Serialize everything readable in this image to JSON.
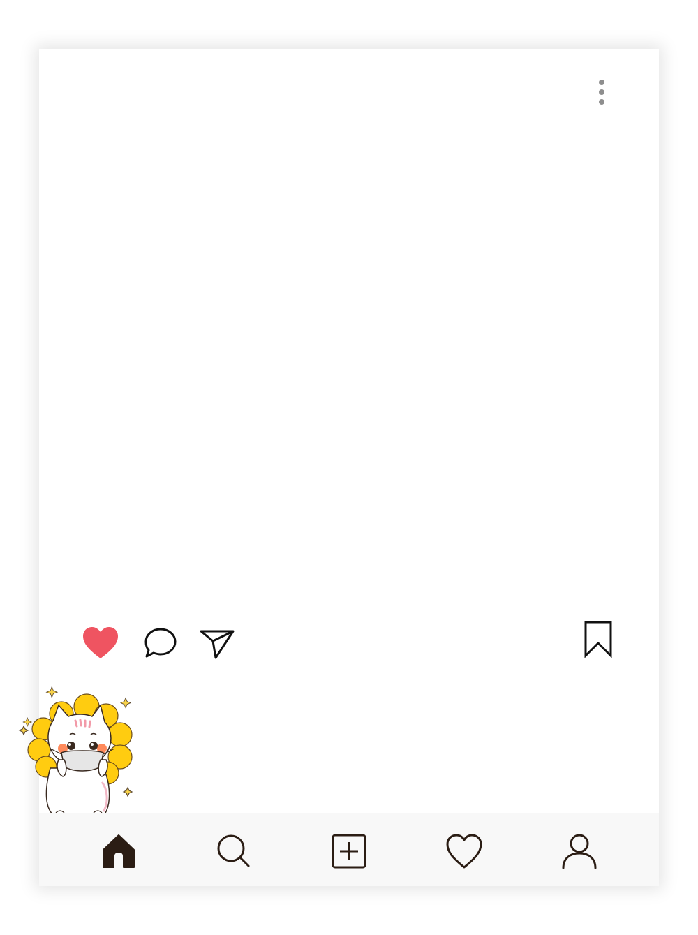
{
  "post": {
    "actions": {
      "like_icon": "heart-filled-icon",
      "comment_icon": "speech-bubble-icon",
      "share_icon": "paper-plane-icon",
      "save_icon": "bookmark-icon",
      "like_color": "#ef5461"
    },
    "menu_icon": "more-vertical-icon"
  },
  "bottom_nav": {
    "items": [
      {
        "icon": "home-icon",
        "active": true
      },
      {
        "icon": "search-icon",
        "active": false
      },
      {
        "icon": "add-post-icon",
        "active": false
      },
      {
        "icon": "heart-outline-icon",
        "active": false
      },
      {
        "icon": "profile-icon",
        "active": false
      }
    ],
    "background": "#f8f8f8",
    "icon_color": "#2b1d14"
  },
  "sticker": {
    "icon": "cat-sunflower-sticker"
  }
}
